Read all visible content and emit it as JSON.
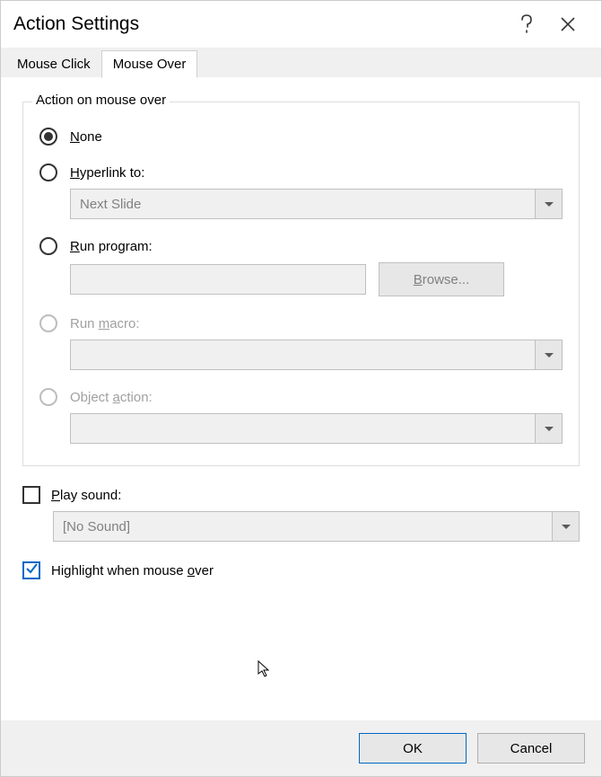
{
  "title": "Action Settings",
  "tabs": {
    "click": "Mouse Click",
    "over": "Mouse Over"
  },
  "group": {
    "legend": "Action on mouse over",
    "none": "None",
    "hyperlink": "Hyperlink to:",
    "hyperlink_value": "Next Slide",
    "run_program": "Run program:",
    "browse": "Browse...",
    "run_macro": "Run macro:",
    "object_action": "Object action:"
  },
  "play_sound": "Play sound:",
  "sound_value": "[No Sound]",
  "highlight": "Highlight when mouse over",
  "buttons": {
    "ok": "OK",
    "cancel": "Cancel"
  }
}
